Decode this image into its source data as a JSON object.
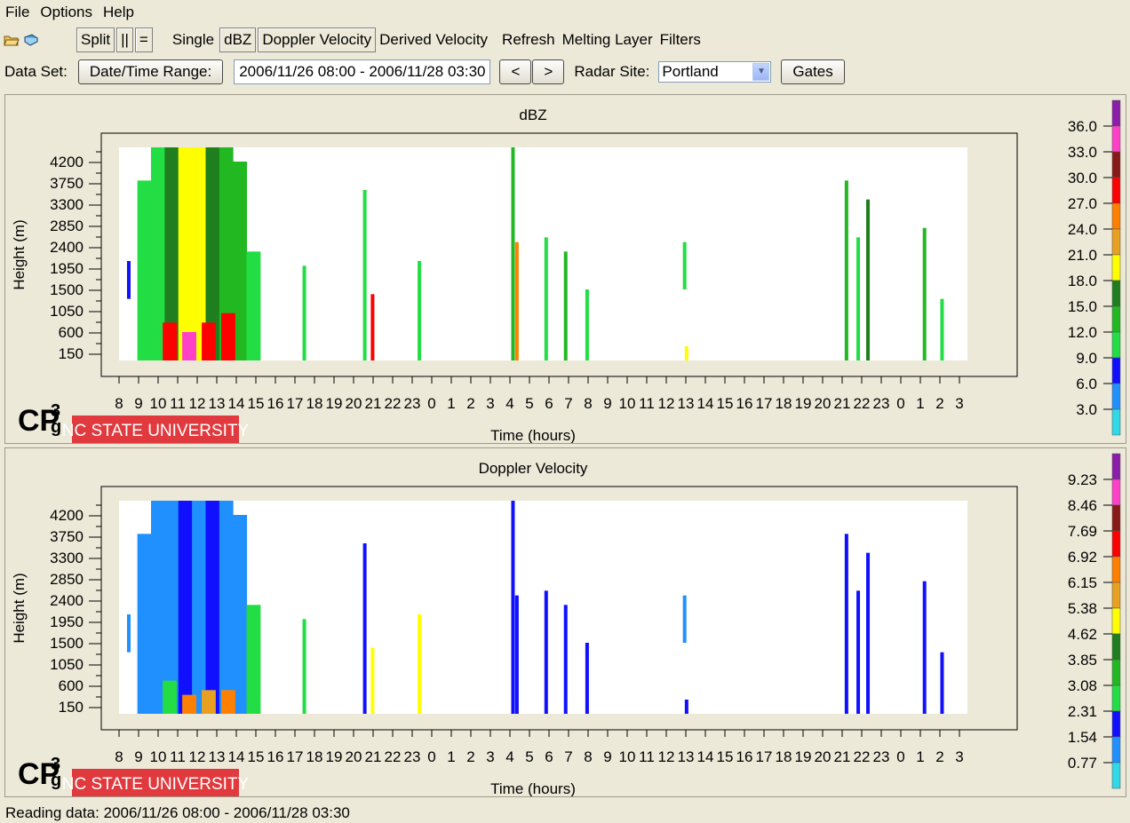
{
  "menu": {
    "file": "File",
    "options": "Options",
    "help": "Help"
  },
  "toolbar": {
    "split": "Split",
    "parallel": "||",
    "equals": "=",
    "single": "Single",
    "dbz": "dBZ",
    "doppler": "Doppler Velocity",
    "derived": "Derived Velocity",
    "refresh": "Refresh",
    "melting": "Melting Layer",
    "filters": "Filters"
  },
  "dataset": {
    "label": "Data Set:",
    "daterange_button": "Date/Time Range:",
    "range_value": "2006/11/26 08:00 - 2006/11/28 03:30",
    "prev": "<",
    "next": ">",
    "radar_label": "Radar Site:",
    "radar_value": "Portland",
    "gates": "Gates"
  },
  "status": {
    "text": "Reading data: 2006/11/26 08:00 - 2006/11/28 03:30"
  },
  "branding": {
    "logo_text": "CP3g",
    "university": "NC STATE UNIVERSITY",
    "university_color": "#e03a3e"
  },
  "chart_data": [
    {
      "type": "heatmap",
      "title": "dBZ",
      "xlabel": "Time (hours)",
      "ylabel": "Height (m)",
      "y_ticks": [
        "4200",
        "3750",
        "3300",
        "2850",
        "2400",
        "1950",
        "1500",
        "1050",
        "600",
        "150"
      ],
      "x_ticks": [
        "8",
        "9",
        "10",
        "11",
        "12",
        "13",
        "14",
        "15",
        "16",
        "17",
        "18",
        "19",
        "20",
        "21",
        "22",
        "23",
        "0",
        "1",
        "2",
        "3",
        "4",
        "5",
        "6",
        "7",
        "8",
        "9",
        "10",
        "11",
        "12",
        "13",
        "14",
        "15",
        "16",
        "17",
        "18",
        "19",
        "20",
        "21",
        "22",
        "23",
        "0",
        "1",
        "2",
        "3"
      ],
      "colorbar": {
        "labels": [
          "36.0",
          "33.0",
          "30.0",
          "27.0",
          "24.0",
          "21.0",
          "18.0",
          "15.0",
          "12.0",
          "9.0",
          "6.0",
          "3.0"
        ],
        "colors": [
          "#8b1ea8",
          "#ff40c8",
          "#8a1a1a",
          "#ff0000",
          "#ff8000",
          "#e8a020",
          "#ffff00",
          "#1f7f1f",
          "#22b822",
          "#22dd44",
          "#1010ff",
          "#2090ff",
          "#30d8e8"
        ]
      },
      "cells": [
        {
          "x": 8.5,
          "y0": 1300,
          "y1": 2100,
          "level": 10
        },
        {
          "x": 9.3,
          "y0": 0,
          "y1": 3800,
          "level": 9
        },
        {
          "x": 10.0,
          "y0": 0,
          "y1": 4500,
          "level": 9
        },
        {
          "x": 10.7,
          "y0": 0,
          "y1": 4500,
          "level": 7
        },
        {
          "x": 11.4,
          "y0": 0,
          "y1": 4500,
          "level": 6
        },
        {
          "x": 12.1,
          "y0": 0,
          "y1": 4500,
          "level": 6
        },
        {
          "x": 12.8,
          "y0": 0,
          "y1": 4500,
          "level": 7
        },
        {
          "x": 13.5,
          "y0": 0,
          "y1": 4500,
          "level": 8
        },
        {
          "x": 14.2,
          "y0": 0,
          "y1": 4200,
          "level": 8
        },
        {
          "x": 14.9,
          "y0": 0,
          "y1": 2300,
          "level": 9
        },
        {
          "x": 10.6,
          "y0": 0,
          "y1": 800,
          "level": 3
        },
        {
          "x": 11.6,
          "y0": 0,
          "y1": 600,
          "level": 1
        },
        {
          "x": 12.6,
          "y0": 0,
          "y1": 800,
          "level": 3
        },
        {
          "x": 13.6,
          "y0": 0,
          "y1": 1000,
          "level": 3
        },
        {
          "x": 17.5,
          "y0": 0,
          "y1": 2000,
          "level": 9
        },
        {
          "x": 20.6,
          "y0": 0,
          "y1": 3600,
          "level": 9
        },
        {
          "x": 21.0,
          "y0": 0,
          "y1": 1400,
          "level": 3
        },
        {
          "x": 23.4,
          "y0": 0,
          "y1": 2100,
          "level": 9
        },
        {
          "x": 28.2,
          "y0": 0,
          "y1": 4500,
          "level": 8
        },
        {
          "x": 28.4,
          "y0": 0,
          "y1": 2500,
          "level": 4
        },
        {
          "x": 29.9,
          "y0": 0,
          "y1": 2600,
          "level": 9
        },
        {
          "x": 30.9,
          "y0": 0,
          "y1": 2300,
          "level": 8
        },
        {
          "x": 32.0,
          "y0": 0,
          "y1": 1500,
          "level": 9
        },
        {
          "x": 37.0,
          "y0": 1500,
          "y1": 2500,
          "level": 9
        },
        {
          "x": 37.1,
          "y0": 0,
          "y1": 300,
          "level": 6
        },
        {
          "x": 45.3,
          "y0": 0,
          "y1": 3800,
          "level": 8
        },
        {
          "x": 45.9,
          "y0": 0,
          "y1": 2600,
          "level": 9
        },
        {
          "x": 46.4,
          "y0": 0,
          "y1": 3400,
          "level": 7
        },
        {
          "x": 49.3,
          "y0": 0,
          "y1": 2800,
          "level": 8
        },
        {
          "x": 50.2,
          "y0": 0,
          "y1": 1300,
          "level": 9
        }
      ]
    },
    {
      "type": "heatmap",
      "title": "Doppler Velocity",
      "xlabel": "Time (hours)",
      "ylabel": "Height (m)",
      "y_ticks": [
        "4200",
        "3750",
        "3300",
        "2850",
        "2400",
        "1950",
        "1500",
        "1050",
        "600",
        "150"
      ],
      "x_ticks": [
        "8",
        "9",
        "10",
        "11",
        "12",
        "13",
        "14",
        "15",
        "16",
        "17",
        "18",
        "19",
        "20",
        "21",
        "22",
        "23",
        "0",
        "1",
        "2",
        "3",
        "4",
        "5",
        "6",
        "7",
        "8",
        "9",
        "10",
        "11",
        "12",
        "13",
        "14",
        "15",
        "16",
        "17",
        "18",
        "19",
        "20",
        "21",
        "22",
        "23",
        "0",
        "1",
        "2",
        "3"
      ],
      "colorbar": {
        "labels": [
          "9.23",
          "8.46",
          "7.69",
          "6.92",
          "6.15",
          "5.38",
          "4.62",
          "3.85",
          "3.08",
          "2.31",
          "1.54",
          "0.77"
        ],
        "colors": [
          "#8b1ea8",
          "#ff40c8",
          "#8a1a1a",
          "#ff0000",
          "#ff8000",
          "#e8a020",
          "#ffff00",
          "#1f7f1f",
          "#22b822",
          "#22dd44",
          "#1010ff",
          "#2090ff",
          "#30d8e8"
        ]
      },
      "cells": [
        {
          "x": 8.5,
          "y0": 1300,
          "y1": 2100,
          "level": 11
        },
        {
          "x": 9.3,
          "y0": 0,
          "y1": 3800,
          "level": 11
        },
        {
          "x": 10.0,
          "y0": 0,
          "y1": 4500,
          "level": 11
        },
        {
          "x": 10.7,
          "y0": 0,
          "y1": 4500,
          "level": 11
        },
        {
          "x": 11.4,
          "y0": 0,
          "y1": 4500,
          "level": 10
        },
        {
          "x": 12.1,
          "y0": 0,
          "y1": 4500,
          "level": 11
        },
        {
          "x": 12.8,
          "y0": 0,
          "y1": 4500,
          "level": 10
        },
        {
          "x": 13.5,
          "y0": 0,
          "y1": 4500,
          "level": 11
        },
        {
          "x": 14.2,
          "y0": 0,
          "y1": 4200,
          "level": 11
        },
        {
          "x": 14.9,
          "y0": 0,
          "y1": 2300,
          "level": 9
        },
        {
          "x": 10.6,
          "y0": 0,
          "y1": 700,
          "level": 9
        },
        {
          "x": 11.6,
          "y0": 0,
          "y1": 400,
          "level": 4
        },
        {
          "x": 12.6,
          "y0": 0,
          "y1": 500,
          "level": 5
        },
        {
          "x": 13.6,
          "y0": 0,
          "y1": 500,
          "level": 4
        },
        {
          "x": 17.5,
          "y0": 0,
          "y1": 2000,
          "level": 9
        },
        {
          "x": 20.6,
          "y0": 0,
          "y1": 3600,
          "level": 10
        },
        {
          "x": 21.0,
          "y0": 0,
          "y1": 1400,
          "level": 6
        },
        {
          "x": 23.4,
          "y0": 0,
          "y1": 2100,
          "level": 6
        },
        {
          "x": 28.2,
          "y0": 0,
          "y1": 4500,
          "level": 10
        },
        {
          "x": 28.4,
          "y0": 0,
          "y1": 2500,
          "level": 10
        },
        {
          "x": 29.9,
          "y0": 0,
          "y1": 2600,
          "level": 10
        },
        {
          "x": 30.9,
          "y0": 0,
          "y1": 2300,
          "level": 10
        },
        {
          "x": 32.0,
          "y0": 0,
          "y1": 1500,
          "level": 10
        },
        {
          "x": 37.0,
          "y0": 1500,
          "y1": 2500,
          "level": 11
        },
        {
          "x": 37.1,
          "y0": 0,
          "y1": 300,
          "level": 10
        },
        {
          "x": 45.3,
          "y0": 0,
          "y1": 3800,
          "level": 10
        },
        {
          "x": 45.9,
          "y0": 0,
          "y1": 2600,
          "level": 10
        },
        {
          "x": 46.4,
          "y0": 0,
          "y1": 3400,
          "level": 10
        },
        {
          "x": 49.3,
          "y0": 0,
          "y1": 2800,
          "level": 10
        },
        {
          "x": 50.2,
          "y0": 0,
          "y1": 1300,
          "level": 10
        }
      ]
    }
  ]
}
